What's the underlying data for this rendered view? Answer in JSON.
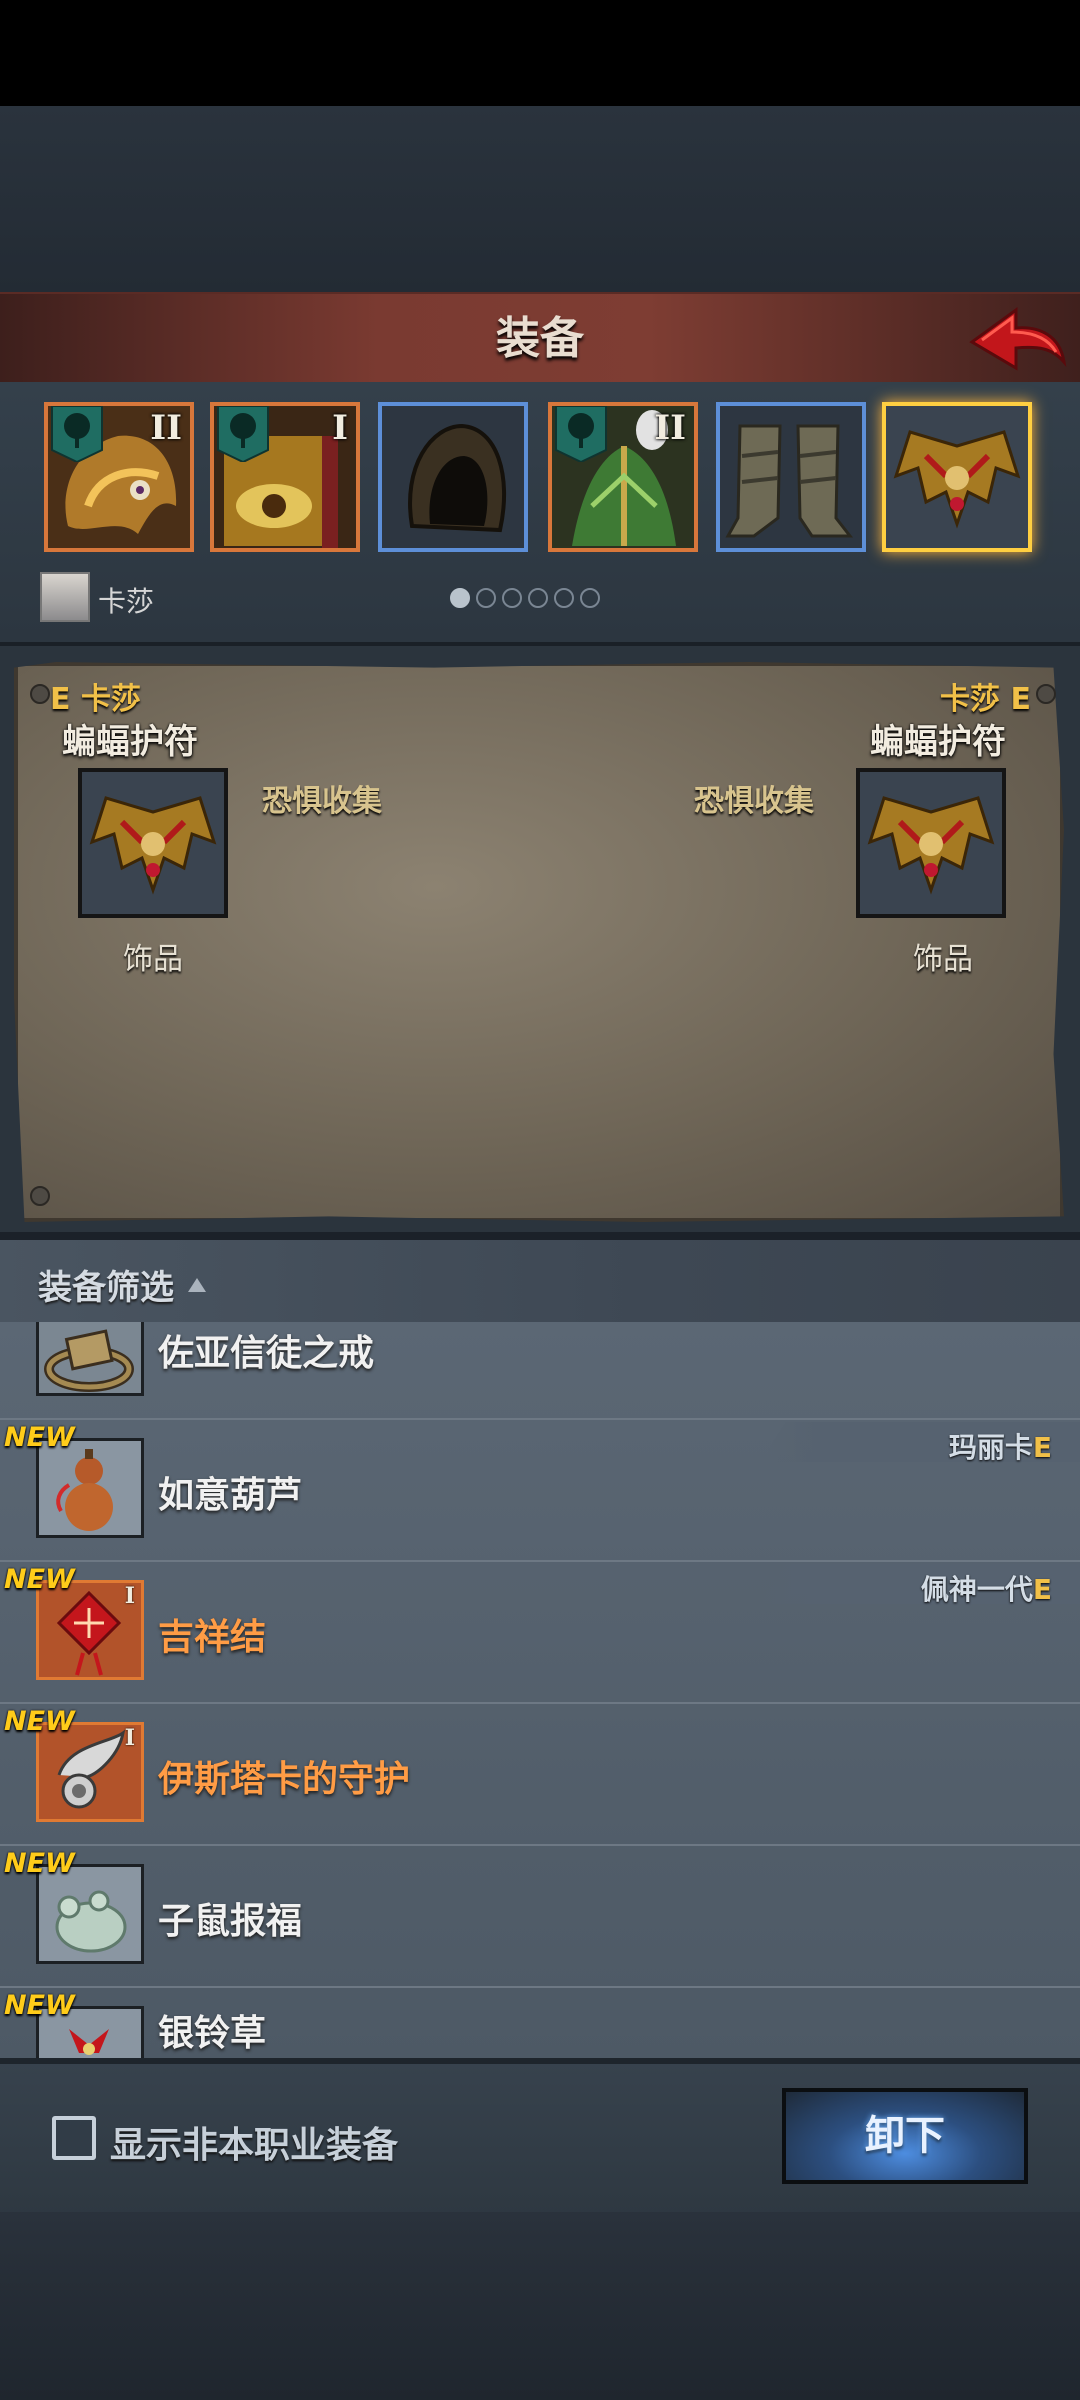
{
  "header": {
    "title": "装备"
  },
  "slots": [
    {
      "art": "dragon-helm-icon",
      "tier": "II",
      "set_badge": true,
      "rarity": "orange"
    },
    {
      "art": "golden-eye-shield-icon",
      "tier": "I",
      "set_badge": true,
      "rarity": "orange"
    },
    {
      "art": "dark-hood-icon",
      "tier": "",
      "set_badge": false,
      "rarity": "blue"
    },
    {
      "art": "leaf-armor-icon",
      "tier": "II",
      "set_badge": true,
      "rarity": "orange"
    },
    {
      "art": "wrapped-boots-icon",
      "tier": "",
      "set_badge": false,
      "rarity": "blue"
    },
    {
      "art": "bat-amulet-icon",
      "tier": "",
      "set_badge": false,
      "rarity": "selected"
    }
  ],
  "character": {
    "name": "卡莎"
  },
  "page_dots": {
    "count": 6,
    "active": 0
  },
  "compare": {
    "left": {
      "owner_grade": "E",
      "owner": "卡莎",
      "item_name": "蝙蝠护符",
      "set_name": "恐惧收集",
      "type": "饰品"
    },
    "right": {
      "owner_grade": "E",
      "owner": "卡莎",
      "item_name": "蝙蝠护符",
      "set_name": "恐惧收集",
      "type": "饰品"
    }
  },
  "filter": {
    "label": "装备筛选"
  },
  "items": [
    {
      "name": "佐亚信徒之戒",
      "new": "",
      "owner": "",
      "owner_grade": "",
      "rarity": "normal",
      "icon": "ring-icon"
    },
    {
      "name": "如意葫芦",
      "new": "NEW",
      "owner": "玛丽卡",
      "owner_grade": "E",
      "rarity": "normal",
      "icon": "gourd-icon"
    },
    {
      "name": "吉祥结",
      "new": "NEW",
      "owner": "佩神一代",
      "owner_grade": "E",
      "rarity": "orange",
      "icon": "chinese-knot-icon",
      "tier": "I"
    },
    {
      "name": "伊斯塔卡的守护",
      "new": "NEW",
      "owner": "",
      "owner_grade": "",
      "rarity": "orange",
      "icon": "horn-pendant-icon",
      "tier": "I"
    },
    {
      "name": "子鼠报福",
      "new": "NEW",
      "owner": "",
      "owner_grade": "",
      "rarity": "normal",
      "icon": "jade-rat-icon"
    },
    {
      "name": "银铃草",
      "new": "NEW",
      "owner": "",
      "owner_grade": "",
      "rarity": "normal",
      "icon": "bell-flower-icon"
    }
  ],
  "bottom": {
    "checkbox_label": "显示非本职业装备",
    "checkbox_checked": false,
    "unequip_label": "卸下"
  }
}
